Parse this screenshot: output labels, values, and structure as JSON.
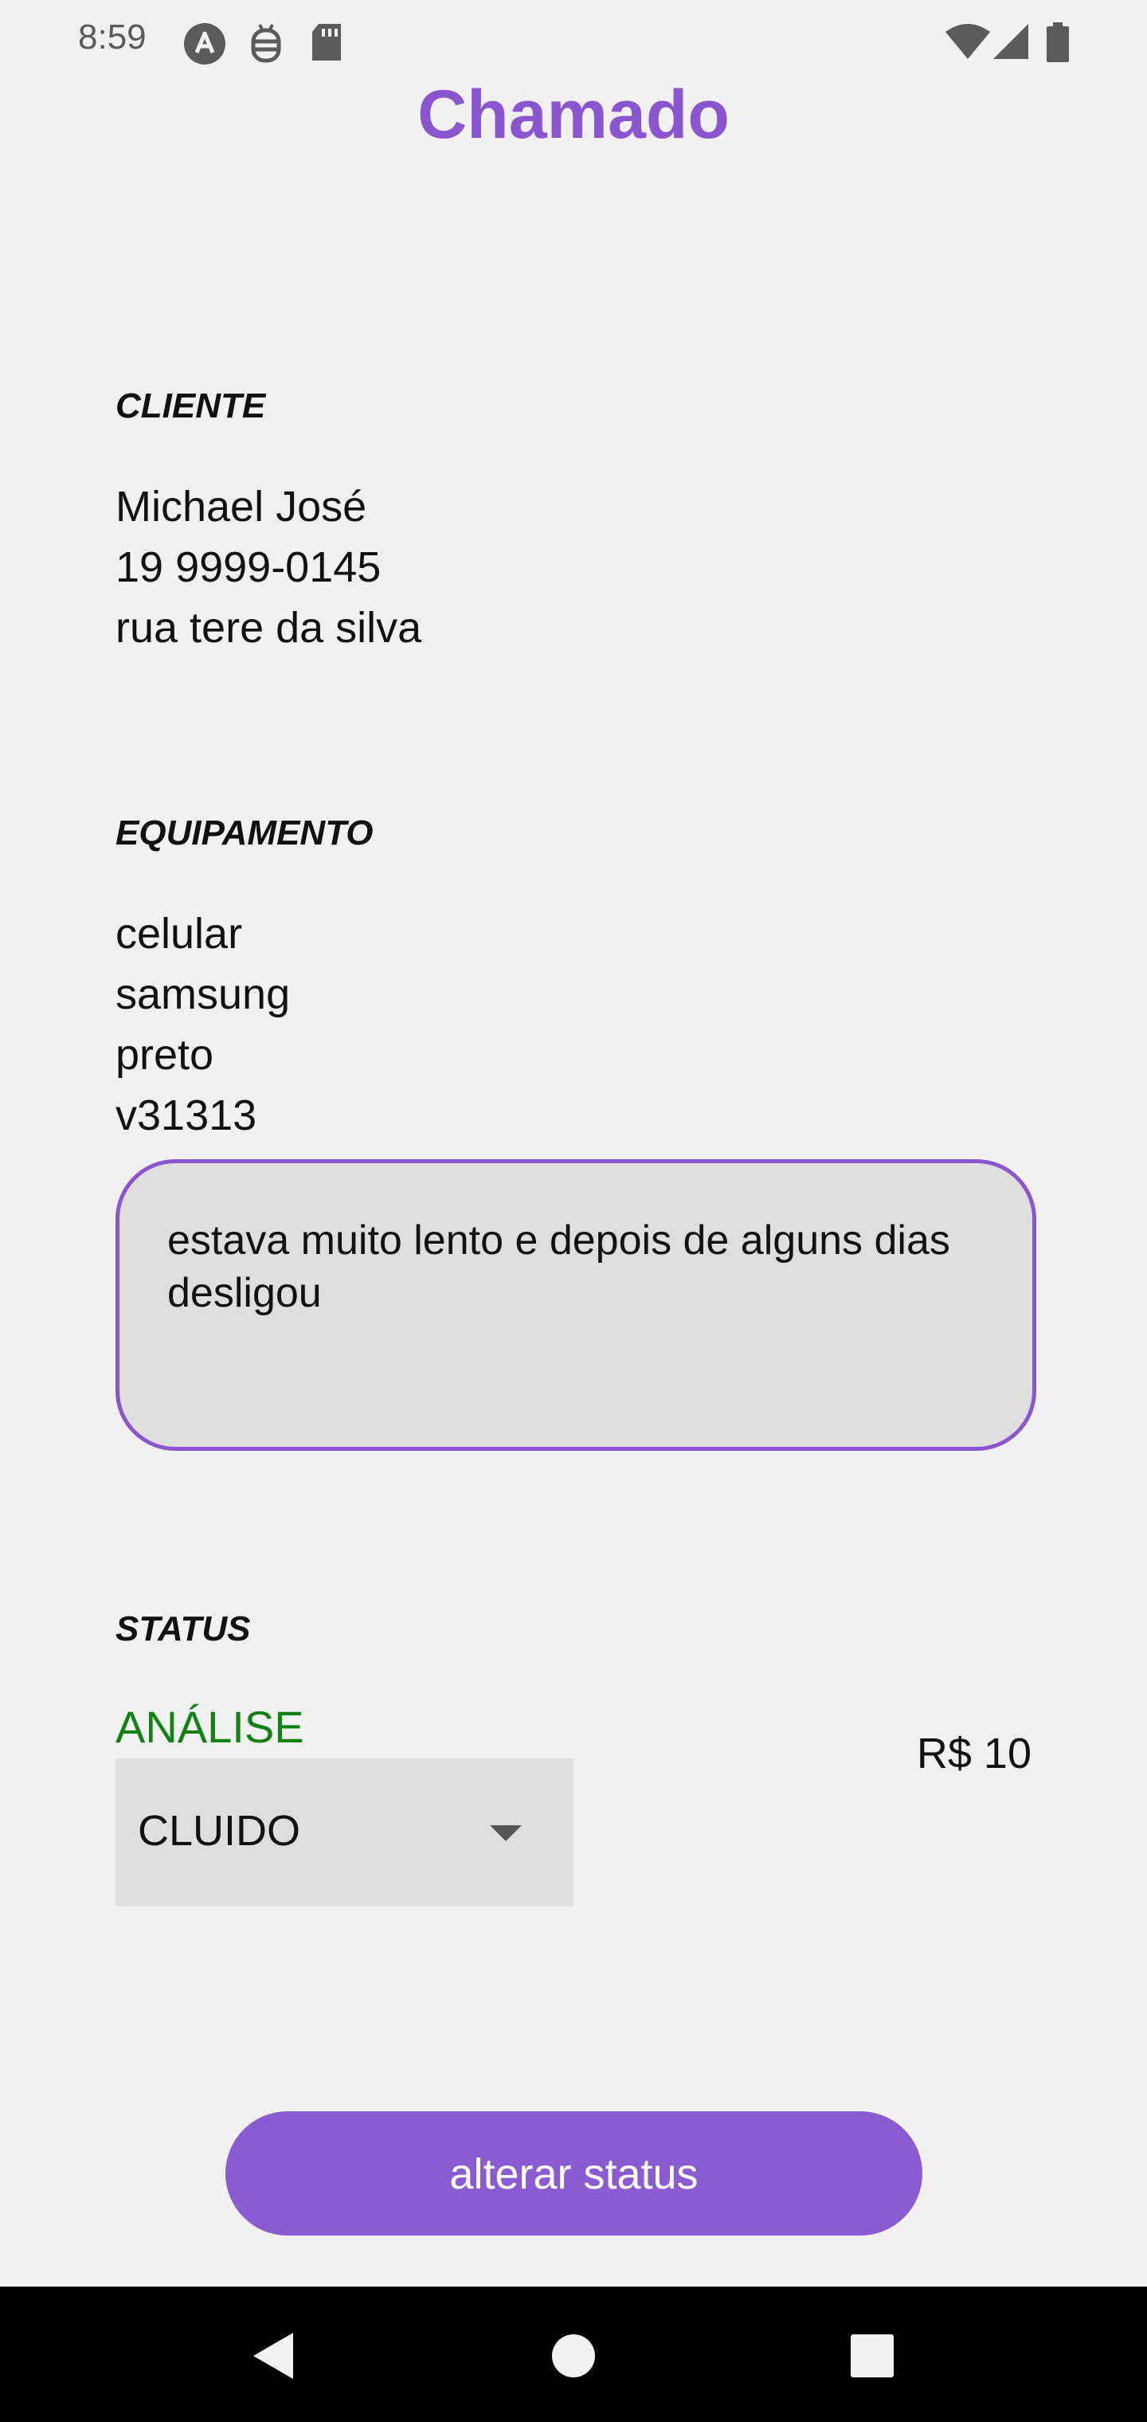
{
  "status_bar": {
    "time": "8:59",
    "icons": [
      "android-icon",
      "debug-icon",
      "sd-card-icon",
      "wifi-icon",
      "signal-icon",
      "battery-icon"
    ]
  },
  "header": {
    "title": "Chamado"
  },
  "cliente": {
    "label": "CLIENTE",
    "name": "Michael José",
    "phone": "19 9999-0145",
    "address": "rua tere da silva"
  },
  "equipamento": {
    "label": "EQUIPAMENTO",
    "type": "celular",
    "brand": "samsung",
    "color": "preto",
    "model": "v31313",
    "description": "estava muito lento e depois de alguns dias desligou"
  },
  "status": {
    "label": "STATUS",
    "current": "ANÁLISE",
    "price": "R$ 10",
    "dropdown_selected": "CLUIDO"
  },
  "actions": {
    "change_status_label": "alterar status"
  },
  "colors": {
    "accent": "#8a55cf",
    "status_green": "#118211",
    "background": "#f2f1f2"
  },
  "nav": {
    "icons": [
      "back-icon",
      "home-icon",
      "recents-icon"
    ]
  }
}
